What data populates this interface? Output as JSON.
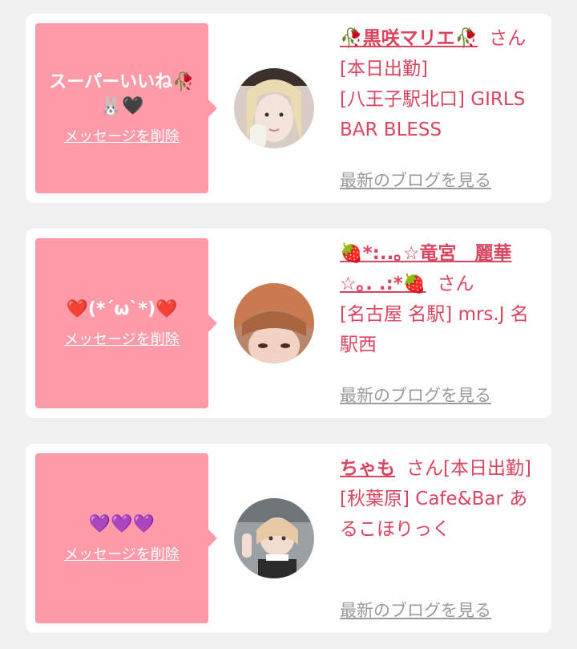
{
  "items": [
    {
      "message": "スーパーいいね🥀🐰🖤",
      "delete_label": "メッセージを削除",
      "name": "🥀黒咲マリエ🥀",
      "honorific": "さん",
      "status": "[本日出勤]",
      "shop": "[八王子駅北口] GIRLS BAR BLESS",
      "blog_label": "最新のブログを見る"
    },
    {
      "message": "❤️(*´ω`*)❤️",
      "delete_label": "メッセージを削除",
      "name": "🍓*:..｡☆竜宮　麗華☆｡. .:*🍓",
      "honorific": "さん",
      "status": "",
      "shop": "[名古屋 名駅] mrs.J 名駅西",
      "blog_label": "最新のブログを見る"
    },
    {
      "message": "💜💜💜",
      "delete_label": "メッセージを削除",
      "name": "ちゃも",
      "honorific": "さん",
      "status": "[本日出勤]",
      "shop": "[秋葉原] Cafe&Bar あるこほりっく",
      "blog_label": "最新のブログを見る"
    }
  ]
}
